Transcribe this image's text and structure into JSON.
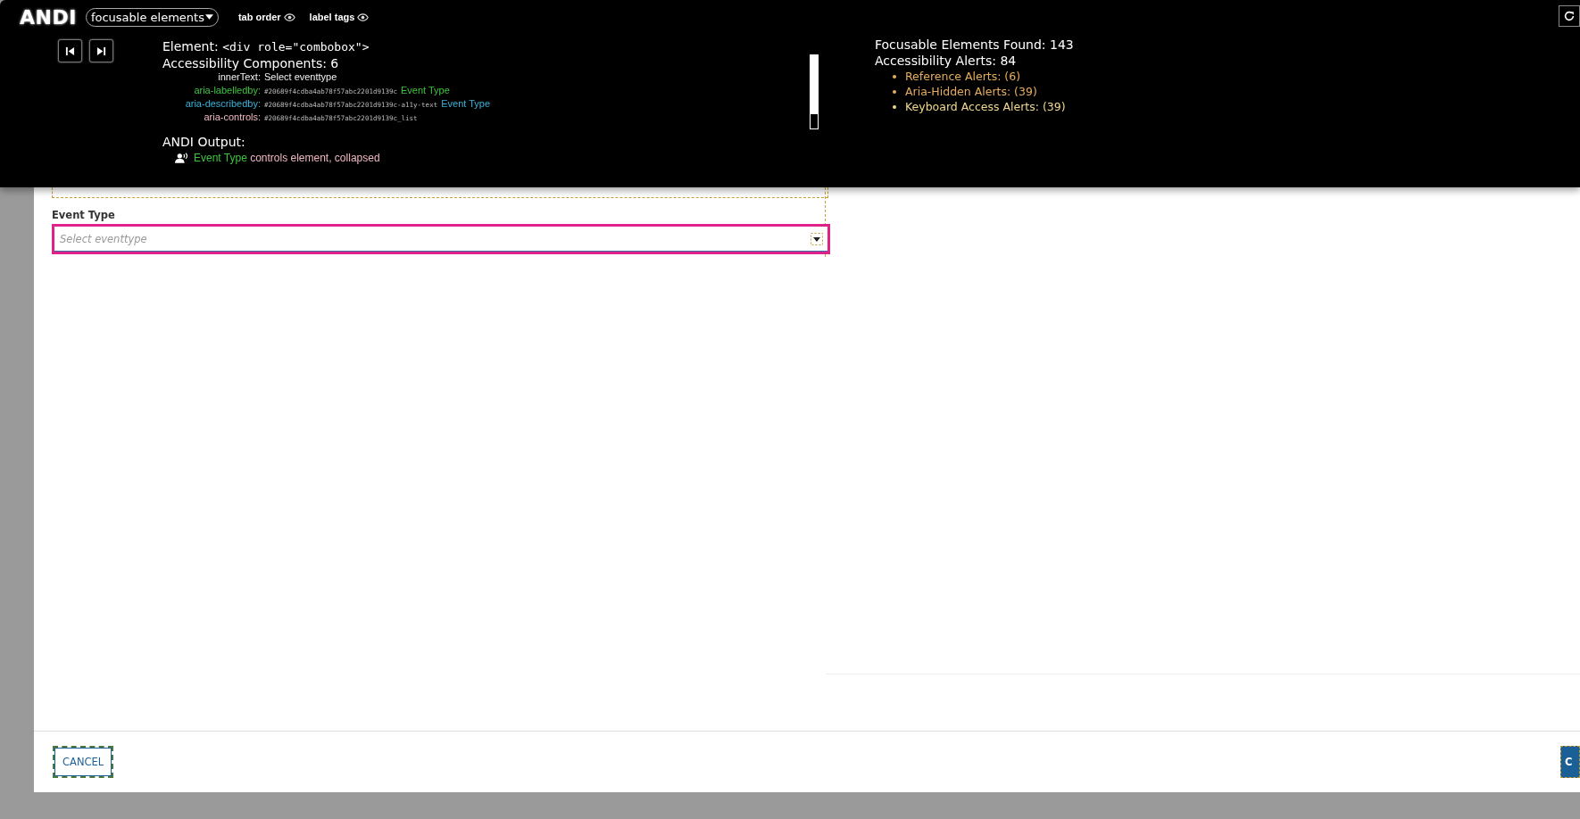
{
  "toolbar": {
    "logo": "ANDI",
    "module_menu": "focusable elements",
    "toggles": [
      {
        "label": "tab order"
      },
      {
        "label": "label tags"
      }
    ]
  },
  "element": {
    "label": "Element:",
    "tag": "<div role=\"combobox\">",
    "components_heading": "Accessibility Components: 6",
    "components": [
      {
        "name": "innerText:",
        "color": "#f2f2f2",
        "value": "Select eventtype"
      },
      {
        "name": "aria-labelledby:",
        "color": "#3fc43f",
        "ref": "#20689f4cdba4ab78f57abc2201d9139c",
        "value": "Event Type"
      },
      {
        "name": "aria-describedby:",
        "color": "#38b2d8",
        "ref": "#20689f4cdba4ab78f57abc2201d9139c-a11y-text",
        "value": "Event Type"
      },
      {
        "name": "aria-controls:",
        "color": "#f2b8c2",
        "ref": "#20689f4cdba4ab78f57abc2201d9139c_list"
      }
    ],
    "output_heading": "ANDI Output:",
    "output": {
      "name": "Event Type",
      "rest": "controls element, collapsed"
    }
  },
  "summary": {
    "found": "Focusable Elements Found: 143",
    "alerts": "Accessibility Alerts: 84",
    "alert_items": [
      {
        "label": "Reference Alerts: (6)",
        "color": "#e6ad5e"
      },
      {
        "label": "Aria-Hidden Alerts: (39)",
        "color": "#e6ad5e"
      },
      {
        "label": "Keyboard Access Alerts: (39)",
        "color": "#f0d98e"
      }
    ]
  },
  "form": {
    "field_label": "Event Type",
    "placeholder": "Select eventtype"
  },
  "footer": {
    "buttons": [
      {
        "label": "CANCEL",
        "kind": "secondary"
      },
      {
        "label": "C",
        "kind": "primary"
      }
    ]
  }
}
